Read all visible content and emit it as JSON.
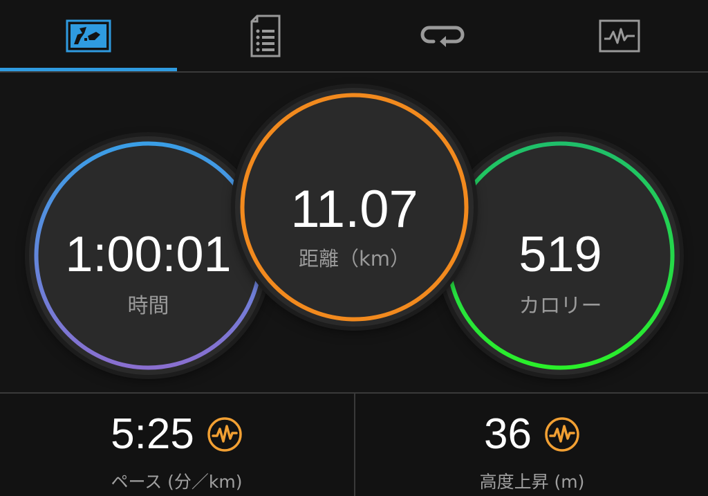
{
  "tabs": [
    {
      "id": "map",
      "icon": "map-icon",
      "active": true
    },
    {
      "id": "details",
      "icon": "document-list-icon",
      "active": false
    },
    {
      "id": "laps",
      "icon": "laps-loop-icon",
      "active": false
    },
    {
      "id": "charts",
      "icon": "activity-chart-icon",
      "active": false
    }
  ],
  "rings": {
    "time": {
      "value": "1:00:01",
      "label": "時間",
      "colors": [
        "#3a9ee6",
        "#7f6fd1"
      ]
    },
    "distance": {
      "value": "11.07",
      "label": "距離（km）",
      "colors": [
        "#f28a1e",
        "#f28a1e"
      ]
    },
    "calories": {
      "value": "519",
      "label": "カロリー",
      "colors": [
        "#1ec85a",
        "#22e32a"
      ]
    }
  },
  "metrics": {
    "pace": {
      "value": "5:25",
      "label": "ペース (分／km)",
      "icon": "orange-pulse-icon"
    },
    "elevation": {
      "value": "36",
      "label": "高度上昇 (m)",
      "icon": "orange-pulse-icon"
    }
  },
  "colors": {
    "accent": "#2f9be0",
    "icon_orange": "#f2a033"
  }
}
